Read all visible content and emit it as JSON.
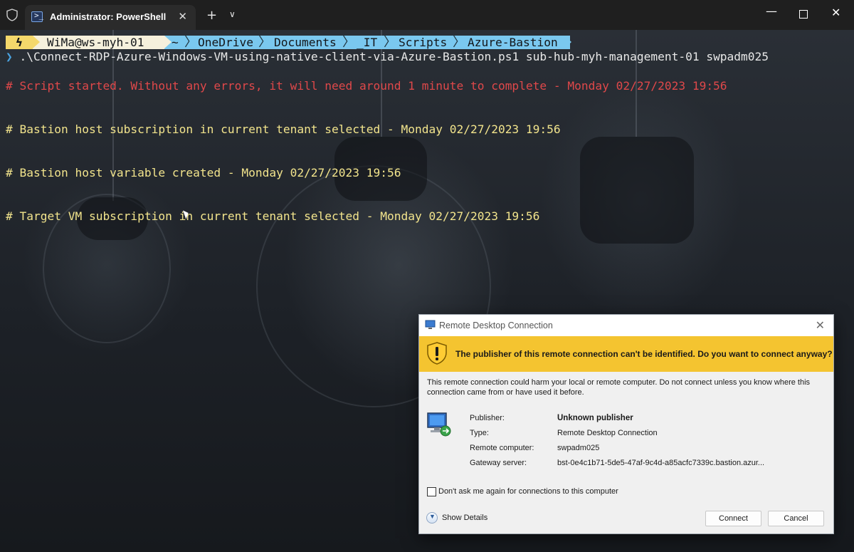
{
  "window": {
    "tab_title": "Administrator: PowerShell",
    "tab_close": "✕",
    "new_tab": "+",
    "tab_dropdown": "∨",
    "minimize": "—",
    "close": "✕"
  },
  "prompt": {
    "bolt": "ϟ",
    "user": "WiMa@ws-myh-01",
    "path": [
      "~",
      "OneDrive",
      "Documents",
      "_IT",
      "Scripts",
      "Azure-Bastion"
    ]
  },
  "command": {
    "chevron": "❯",
    "text": " .\\Connect-RDP-Azure-Windows-VM-using-native-client-via-Azure-Bastion.ps1 sub-hub-myh-management-01 swpadm025"
  },
  "output": [
    {
      "text": "# Script started. Without any errors, it will need around 1 minute to complete - Monday 02/27/2023 19:56",
      "color": "red"
    },
    {
      "text": "# Bastion host subscription in current tenant selected - Monday 02/27/2023 19:56",
      "color": "yellow"
    },
    {
      "text": "# Bastion host variable created - Monday 02/27/2023 19:56",
      "color": "yellow"
    },
    {
      "text": "# Target VM subscription in current tenant selected - Monday 02/27/2023 19:56",
      "color": "yellow"
    }
  ],
  "dialog": {
    "title": "Remote Desktop Connection",
    "close": "✕",
    "warning": "The publisher of this remote connection can't be identified. Do you want to connect anyway?",
    "description": "This remote connection could harm your local or remote computer. Do not connect unless you know where this connection came from or have used it before.",
    "fields": [
      {
        "label": "Publisher:",
        "value": "Unknown publisher"
      },
      {
        "label": "Type:",
        "value": "Remote Desktop Connection"
      },
      {
        "label": "Remote computer:",
        "value": "swpadm025"
      },
      {
        "label": "Gateway server:",
        "value": "bst-0e4c1b71-5de5-47af-9c4d-a85acfc7339c.bastion.azur..."
      }
    ],
    "checkbox_label": "Don't ask me again for connections to this computer",
    "checkbox_checked": false,
    "show_details": "Show Details",
    "connect": "Connect",
    "cancel": "Cancel"
  },
  "colors": {
    "accent_warning": "#f4c430",
    "prompt_yellow": "#f4d86b",
    "prompt_path_blue": "#7ac8ef",
    "output_red": "#e0484a",
    "output_yellow": "#f2e48c"
  }
}
